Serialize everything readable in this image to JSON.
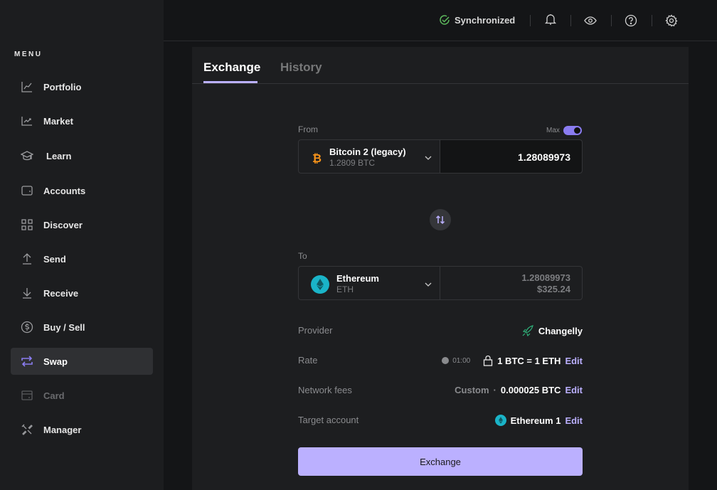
{
  "sidebar": {
    "menu_title": "MENU",
    "items": [
      {
        "label": "Portfolio",
        "icon": "chart-line-icon",
        "state": "normal"
      },
      {
        "label": "Market",
        "icon": "market-chart-icon",
        "state": "normal"
      },
      {
        "label": "Learn",
        "icon": "graduation-cap-icon",
        "state": "normal"
      },
      {
        "label": "Accounts",
        "icon": "wallet-icon",
        "state": "normal"
      },
      {
        "label": "Discover",
        "icon": "grid-icon",
        "state": "normal"
      },
      {
        "label": "Send",
        "icon": "arrow-up-icon",
        "state": "normal"
      },
      {
        "label": "Receive",
        "icon": "arrow-down-icon",
        "state": "normal"
      },
      {
        "label": "Buy / Sell",
        "icon": "dollar-circle-icon",
        "state": "normal"
      },
      {
        "label": "Swap",
        "icon": "swap-arrows-icon",
        "state": "active"
      },
      {
        "label": "Card",
        "icon": "card-icon",
        "state": "disabled"
      },
      {
        "label": "Manager",
        "icon": "tools-icon",
        "state": "normal"
      }
    ]
  },
  "topbar": {
    "sync_status": "Synchronized",
    "icons": [
      "bell-icon",
      "eye-icon",
      "help-icon",
      "gear-icon"
    ]
  },
  "colors": {
    "accent": "#bbb0ff",
    "toggle": "#8a7cf0",
    "sync_green": "#5cb85c",
    "btc_orange": "#f7931a",
    "eth_teal": "#1ab4c8",
    "changelly_green": "#2fb27a"
  },
  "tabs": [
    {
      "label": "Exchange",
      "active": true
    },
    {
      "label": "History",
      "active": false
    }
  ],
  "form": {
    "from": {
      "label": "From",
      "max_label": "Max",
      "max_enabled": true,
      "coin_name": "Bitcoin 2 (legacy)",
      "coin_balance": "1.2809 BTC",
      "amount": "1.28089973"
    },
    "to": {
      "label": "To",
      "coin_name": "Ethereum",
      "coin_ticker": "ETH",
      "amount": "1.28089973",
      "fiat": "$325.24"
    },
    "details": {
      "provider_label": "Provider",
      "provider_value": "Changelly",
      "rate_label": "Rate",
      "rate_timer": "01:00",
      "rate_value": "1 BTC = 1 ETH",
      "fees_label": "Network fees",
      "fees_mode": "Custom",
      "fees_separator": "·",
      "fees_value": "0.000025 BTC",
      "target_label": "Target account",
      "target_value": "Ethereum 1",
      "edit_label": "Edit"
    },
    "submit_label": "Exchange"
  }
}
